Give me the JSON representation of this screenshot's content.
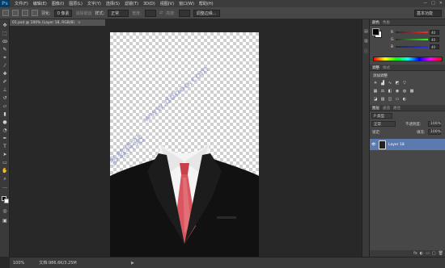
{
  "app": {
    "logo": "Ps"
  },
  "menu": [
    "文件(F)",
    "编辑(E)",
    "图像(I)",
    "图层(L)",
    "文字(Y)",
    "选择(S)",
    "滤镜(T)",
    "3D(D)",
    "视图(V)",
    "窗口(W)",
    "帮助(H)"
  ],
  "window_controls": [
    "—",
    "□",
    "✕"
  ],
  "options": {
    "feather_label": "羽化:",
    "feather_value": "0 像素",
    "antialias": "消除锯齿",
    "style_label": "样式:",
    "style_value": "正常",
    "width_label": "宽度:",
    "height_label": "高度:",
    "refine": "调整边缘...",
    "workspace": "基本功能"
  },
  "document": {
    "tab_title": "01.psd @ 100% (Layer 18, RGB/8)",
    "close": "×"
  },
  "watermark": "多多软件站",
  "watermark_url": "www.ddooo.com",
  "status": {
    "zoom": "100%",
    "doc_info": "文档:986.6K/3.25M",
    "arrow": "▶"
  },
  "color_panel": {
    "tabs": [
      "颜色",
      "色板"
    ],
    "r_label": "R",
    "r_value": "40",
    "g_label": "G",
    "g_value": "40",
    "b_label": "B",
    "b_value": "40"
  },
  "adjust_panel": {
    "tabs": [
      "调整",
      "样式"
    ],
    "title": "添加调整"
  },
  "layers_panel": {
    "tabs": [
      "图层",
      "通道",
      "路径"
    ],
    "kind": "P 类型",
    "blend_mode": "正常",
    "opacity_label": "不透明度:",
    "opacity_value": "100%",
    "lock_label": "锁定:",
    "fill_label": "填充:",
    "fill_value": "100%",
    "layer_name": "Layer 18",
    "bottom_icons": [
      "fx",
      "◐",
      "▭",
      "▢",
      "🗑"
    ]
  },
  "colors": {
    "accent": "#5b7bb0",
    "logo_bg": "#0a3a5e",
    "logo_fg": "#2fa6f0"
  }
}
